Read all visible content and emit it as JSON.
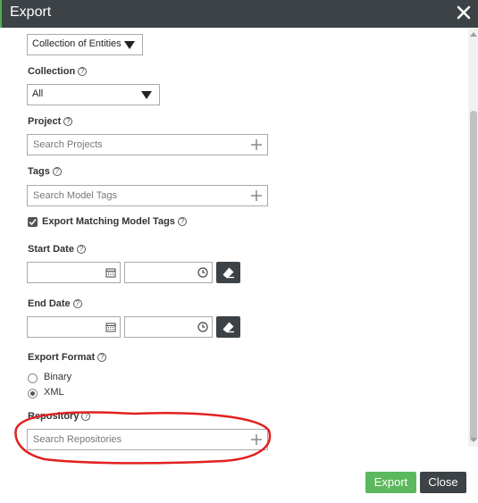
{
  "window": {
    "title": "Export"
  },
  "export_type": {
    "selected": "Collection of Entities"
  },
  "collection": {
    "label": "Collection",
    "selected": "All"
  },
  "project": {
    "label": "Project",
    "placeholder": "Search Projects"
  },
  "tags": {
    "label": "Tags",
    "placeholder": "Search Model Tags"
  },
  "matching_tags": {
    "label": "Export Matching Model Tags",
    "checked": true
  },
  "start_date": {
    "label": "Start Date"
  },
  "end_date": {
    "label": "End Date"
  },
  "export_format": {
    "label": "Export Format",
    "options": [
      "Binary",
      "XML"
    ],
    "selected": "XML"
  },
  "repository": {
    "label": "Repository",
    "placeholder": "Search Repositories"
  },
  "footer": {
    "export_label": "Export",
    "close_label": "Close"
  },
  "colors": {
    "titlebar": "#3c4245",
    "export_button": "#5cb85c",
    "close_button": "#3c4245",
    "annotation": "#e02020"
  }
}
